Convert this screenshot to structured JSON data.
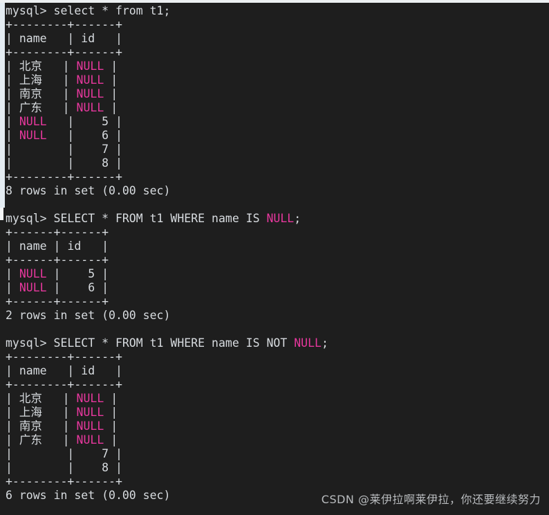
{
  "terminal": {
    "background_color": "#1e1e1e",
    "text_color": "#d8dce0",
    "null_color": "#e8389e",
    "prompt": "mysql>"
  },
  "watermark": {
    "text": "CSDN @莱伊拉啊莱伊拉，你还要继续努力"
  },
  "blocks": [
    {
      "name": "select-all-block",
      "command": "mysql> select * from t1;",
      "rule_top": "+--------+------+",
      "header": "| name   | id   |",
      "rule_mid": "+--------+------+",
      "rows": [
        "| 北京   | NULL |",
        "| 上海   | NULL |",
        "| 南京   | NULL |",
        "| 广东   | NULL |",
        "| NULL   |    5 |",
        "| NULL   |    6 |",
        "|        |    7 |",
        "|        |    8 |"
      ],
      "rule_bottom": "+--------+------+",
      "status": "8 rows in set (0.00 sec)"
    },
    {
      "name": "is-null-block",
      "command": "mysql> SELECT * FROM t1 WHERE name IS NULL;",
      "rule_top": "+------+------+",
      "header": "| name | id   |",
      "rule_mid": "+------+------+",
      "rows": [
        "| NULL |    5 |",
        "| NULL |    6 |"
      ],
      "rule_bottom": "+------+------+",
      "status": "2 rows in set (0.00 sec)"
    },
    {
      "name": "is-not-null-block",
      "command": "mysql> SELECT * FROM t1 WHERE name IS NOT NULL;",
      "rule_top": "+--------+------+",
      "header": "| name   | id   |",
      "rule_mid": "+--------+------+",
      "rows": [
        "| 北京   | NULL |",
        "| 上海   | NULL |",
        "| 南京   | NULL |",
        "| 广东   | NULL |",
        "|        |    7 |",
        "|        |    8 |"
      ],
      "rule_bottom": "+--------+------+",
      "status": "6 rows in set (0.00 sec)"
    }
  ]
}
